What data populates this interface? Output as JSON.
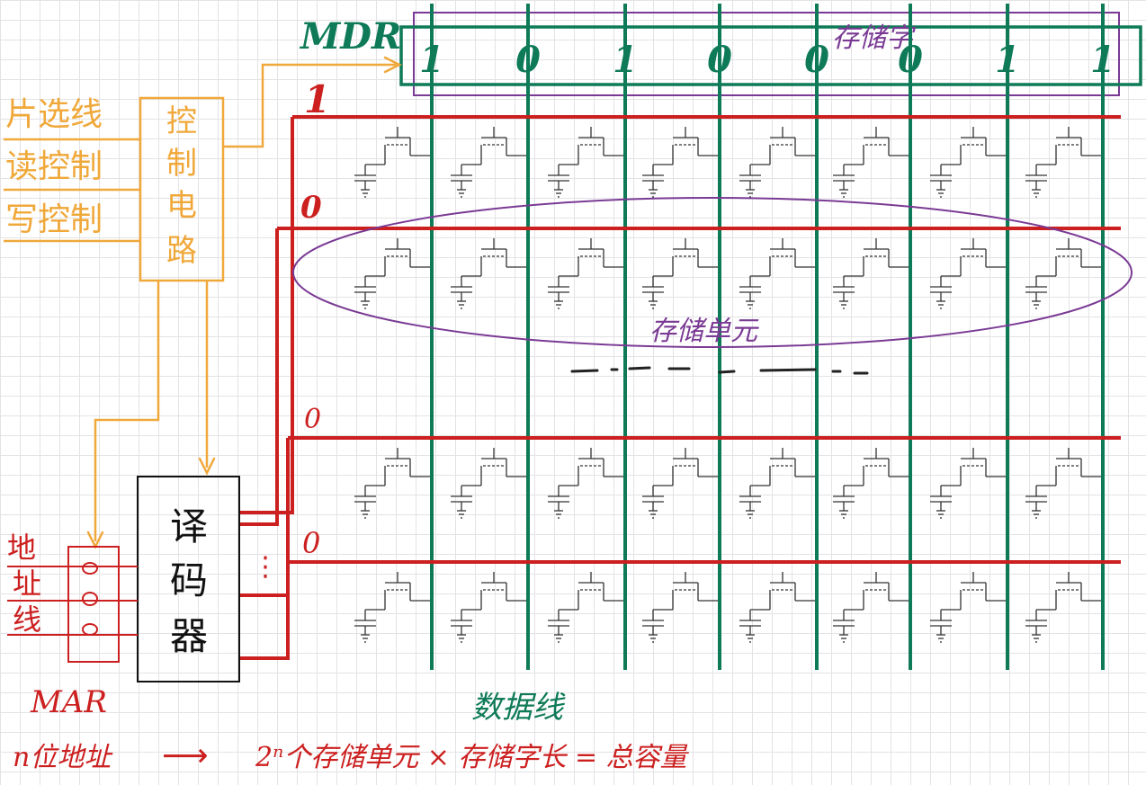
{
  "colors": {
    "control": "#f0a83a",
    "word_line": "#cc1f1f",
    "data_line": "#0e7a57",
    "storage_word": "#7a3a94",
    "cell": "#333333",
    "text_red": "#cc1f1f"
  },
  "mdr": {
    "label": "MDR",
    "bits": [
      "1",
      "0",
      "1",
      "0",
      "0",
      "0",
      "1",
      "1"
    ]
  },
  "storage_word_label": "存储字",
  "control_inputs": [
    "片选线",
    "读控制",
    "写控制"
  ],
  "control_circuit": {
    "chars": [
      "控",
      "制",
      "电",
      "路"
    ]
  },
  "decoder": {
    "chars": [
      "译",
      "码",
      "器"
    ],
    "dots": "⋮"
  },
  "address_lines": {
    "chars": [
      "地",
      "址",
      "线"
    ]
  },
  "mar": {
    "label": "MAR"
  },
  "word_line_values": [
    "1",
    "0",
    "0",
    "0"
  ],
  "storage_unit_label": "存储单元",
  "data_lines_label": "数据线",
  "footnote": {
    "left": "n位地址",
    "arrow": "⟶",
    "right": "2ⁿ个存储单元 × 存储字长 = 总容量"
  },
  "grid": {
    "columns": 8,
    "rows": 4
  }
}
